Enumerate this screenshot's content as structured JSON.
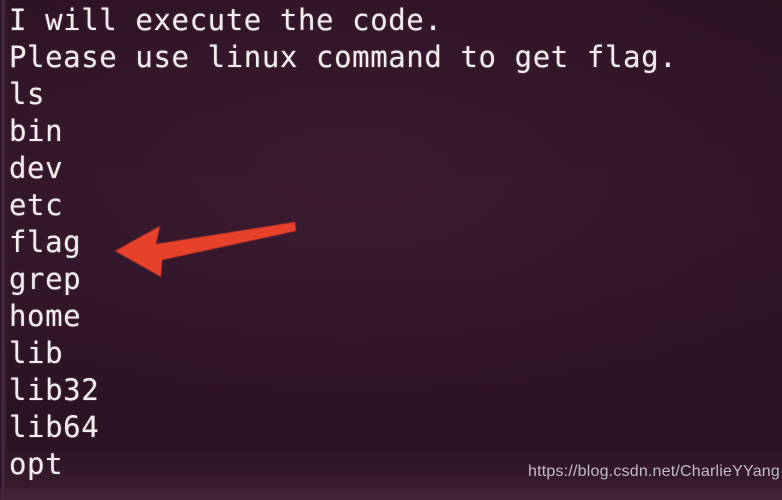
{
  "terminal": {
    "lines": [
      "I will execute the code.",
      "Please use linux command to get flag.",
      "ls",
      "bin",
      "dev",
      "etc",
      "flag",
      "grep",
      "home",
      "lib",
      "lib32",
      "lib64",
      "opt"
    ],
    "prompt_message": "Please use linux command to get flag.",
    "command_entered": "ls",
    "highlighted_entry": "flag",
    "text_color": "#f2eef0",
    "background_color": "#2c1424"
  },
  "annotation": {
    "arrow": {
      "name": "red-arrow-pointing-to-flag",
      "direction": "left",
      "color": "#e8412a",
      "points_at": "flag"
    }
  },
  "watermark": {
    "text": "https://blog.csdn.net/CharlieYYang"
  }
}
